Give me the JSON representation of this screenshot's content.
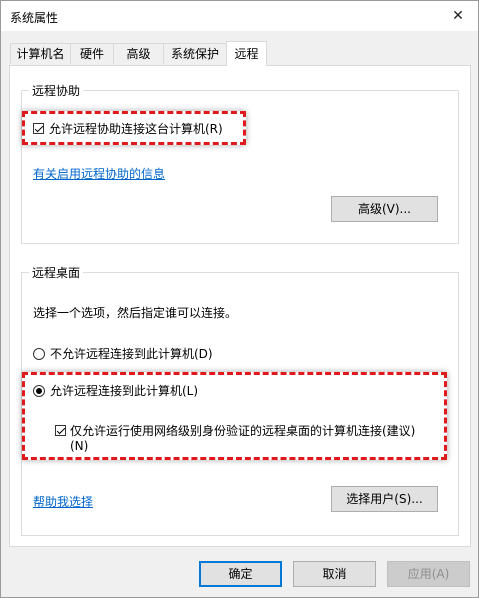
{
  "window": {
    "title": "系统属性"
  },
  "tabs": [
    {
      "label": "计算机名"
    },
    {
      "label": "硬件"
    },
    {
      "label": "高级"
    },
    {
      "label": "系统保护"
    },
    {
      "label": "远程"
    }
  ],
  "remote_assistance": {
    "group_label": "远程协助",
    "checkbox_label": "允许远程协助连接这台计算机(R)",
    "checkbox_checked": true,
    "info_link": "有关启用远程协助的信息",
    "advanced_button": "高级(V)..."
  },
  "remote_desktop": {
    "group_label": "远程桌面",
    "instruction": "选择一个选项，然后指定谁可以连接。",
    "option_disallow": "不允许远程连接到此计算机(D)",
    "option_allow": "允许远程连接到此计算机(L)",
    "selected_option": "allow",
    "nla_checkbox_label_line1": "仅允许运行使用网络级别身份验证的远程桌面的计算机连接(建议)",
    "nla_checkbox_label_line2": "(N)",
    "nla_checked": true,
    "help_link": "帮助我选择",
    "select_users_button": "选择用户(S)..."
  },
  "footer": {
    "ok": "确定",
    "cancel": "取消",
    "apply": "应用(A)"
  },
  "annotation_color": "#e0191c"
}
